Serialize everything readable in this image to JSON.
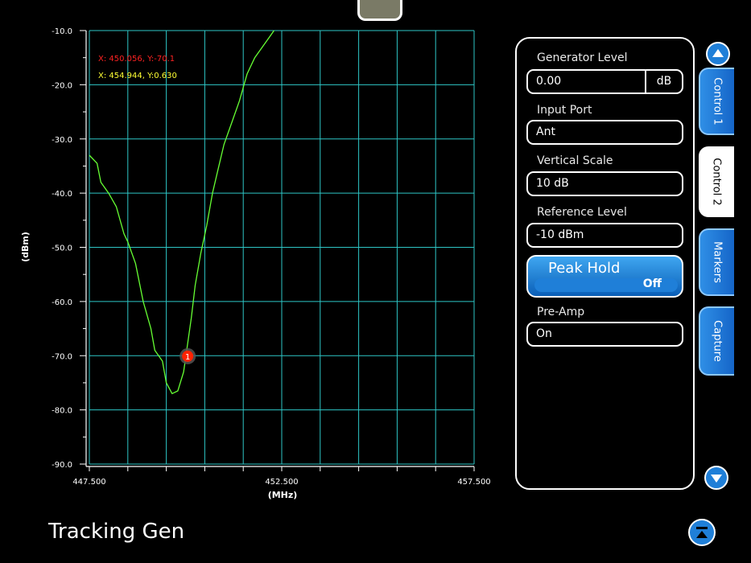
{
  "chart_data": {
    "type": "line",
    "xlabel": "(MHz)",
    "ylabel": "(dBm)",
    "xlim": [
      447.5,
      457.5
    ],
    "ylim": [
      -90,
      -10
    ],
    "x_tick_labels": [
      "447.500",
      "452.500",
      "457.500"
    ],
    "y_tick_labels": [
      "-10.0",
      "-20.0",
      "-30.0",
      "-40.0",
      "-50.0",
      "-60.0",
      "-70.0",
      "-80.0",
      "-90.0"
    ],
    "grid": true,
    "series": [
      {
        "color": "#66ff33",
        "x": [
          447.5,
          447.7,
          447.8,
          448.0,
          448.2,
          448.4,
          448.5,
          448.7,
          448.9,
          449.1,
          449.2,
          449.4,
          449.5,
          449.65,
          449.8,
          449.95,
          450.05,
          450.15,
          450.25,
          450.4,
          450.55,
          450.7,
          450.85,
          451.0,
          451.2,
          451.4,
          451.6,
          451.8,
          452.0,
          452.2,
          452.3
        ],
        "y": [
          -33.0,
          -34.5,
          -38.0,
          -40.0,
          -42.5,
          -47.5,
          -49.0,
          -53.0,
          -60.0,
          -65.0,
          -69.0,
          -71.0,
          -75.0,
          -77.0,
          -76.5,
          -73.0,
          -68.0,
          -63.0,
          -57.0,
          -51.0,
          -46.0,
          -40.0,
          -35.5,
          -31.0,
          -27.0,
          -23.0,
          -18.0,
          -15.0,
          -13.0,
          -11.0,
          -10.0
        ]
      }
    ],
    "markers": [
      {
        "label": "1",
        "x": 450.056,
        "y": -70.1,
        "color": "#ff2200"
      }
    ],
    "readouts": [
      {
        "text": "X: 450.056, Y:-70.1",
        "color": "#ff2222"
      },
      {
        "text": "X: 454.944, Y:0.630",
        "color": "#ffff33"
      }
    ]
  },
  "controls": {
    "generator_level": {
      "label": "Generator Level",
      "value": "0.00",
      "unit": "dB"
    },
    "input_port": {
      "label": "Input Port",
      "value": "Ant"
    },
    "vertical_scale": {
      "label": "Vertical Scale",
      "value": "10 dB"
    },
    "reference_level": {
      "label": "Reference Level",
      "value": "-10 dBm"
    },
    "peak_hold": {
      "label": "Peak Hold",
      "value": "Off"
    },
    "pre_amp": {
      "label": "Pre-Amp",
      "value": "On"
    }
  },
  "tabs": [
    {
      "label": "Control 1",
      "active": false
    },
    {
      "label": "Control 2",
      "active": true
    },
    {
      "label": "Markers",
      "active": false
    },
    {
      "label": "Capture",
      "active": false
    }
  ],
  "mode_title": "Tracking Gen",
  "icons": {
    "scroll_up": "chevron-up-icon",
    "scroll_down": "chevron-down-icon",
    "collapse": "collapse-icon"
  }
}
